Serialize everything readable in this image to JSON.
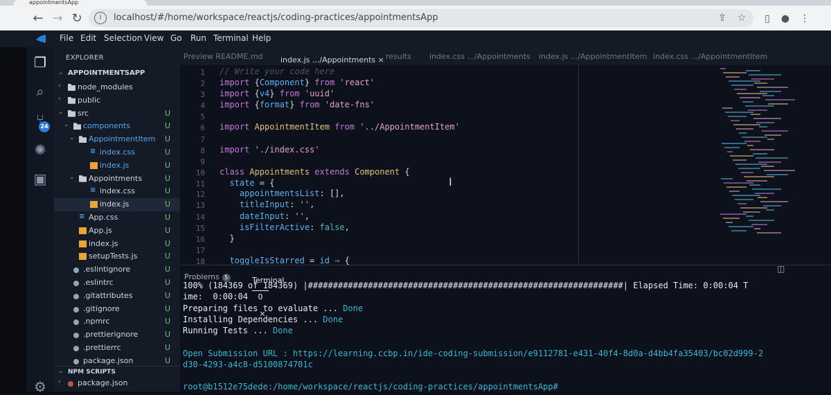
{
  "browser": {
    "tab_title": "appointmentsApp",
    "url": "localhost/#/home/workspace/reactjs/coding-practices/appointmentsApp"
  },
  "menu": [
    "File",
    "Edit",
    "Selection",
    "View",
    "Go",
    "Run",
    "Terminal",
    "Help"
  ],
  "activity_badge": "24",
  "explorer": {
    "header": "EXPLORER",
    "project": "APPOINTMENTSAPP",
    "rows": [
      {
        "label": "node_modules",
        "type": "folder",
        "chev": "›",
        "status": ""
      },
      {
        "label": "public",
        "type": "folder",
        "chev": "›",
        "status": ""
      },
      {
        "label": "src",
        "type": "folder",
        "chev": "⌄",
        "status": "U"
      },
      {
        "label": "components",
        "type": "folder",
        "chev": "⌄",
        "status": "U"
      },
      {
        "label": "AppointmentItem",
        "type": "folder",
        "chev": "⌄",
        "status": "U"
      },
      {
        "label": "index.css",
        "type": "css",
        "chev": "",
        "status": "U"
      },
      {
        "label": "index.js",
        "type": "js",
        "chev": "",
        "status": "U"
      },
      {
        "label": "Appointments",
        "type": "folder",
        "chev": "⌄",
        "status": "U"
      },
      {
        "label": "index.css",
        "type": "css",
        "chev": "",
        "status": "U"
      },
      {
        "label": "index.js",
        "type": "js",
        "chev": "",
        "status": "U"
      },
      {
        "label": "App.css",
        "type": "css",
        "chev": "",
        "status": "U"
      },
      {
        "label": "App.js",
        "type": "js",
        "chev": "",
        "status": "U"
      },
      {
        "label": "index.js",
        "type": "js",
        "chev": "",
        "status": "U"
      },
      {
        "label": "setupTests.js",
        "type": "js",
        "chev": "",
        "status": "U"
      },
      {
        "label": ".eslintignore",
        "type": "dot",
        "chev": "",
        "status": "U"
      },
      {
        "label": ".eslintrc",
        "type": "dot",
        "chev": "",
        "status": "U"
      },
      {
        "label": ".gitattributes",
        "type": "dot",
        "chev": "",
        "status": "U"
      },
      {
        "label": ".gitignore",
        "type": "dot",
        "chev": "",
        "status": "U"
      },
      {
        "label": ".npmrc",
        "type": "dot",
        "chev": "",
        "status": "U"
      },
      {
        "label": ".prettierignore",
        "type": "dot",
        "chev": "",
        "status": "U"
      },
      {
        "label": ".prettierrc",
        "type": "dot",
        "chev": "",
        "status": "U"
      },
      {
        "label": "package.json",
        "type": "dot",
        "chev": "",
        "status": "U"
      }
    ],
    "npm_header": "NPM SCRIPTS",
    "npm_item": "package.json"
  },
  "editor_tabs": [
    {
      "label": "Preview README.md",
      "active": false
    },
    {
      "label": "index.js .../Appointments",
      "active": true,
      "close": "×"
    },
    {
      "label": "results",
      "active": false
    },
    {
      "label": "index.css .../Appointments",
      "active": false
    },
    {
      "label": "index.js .../AppointmentItem",
      "active": false
    },
    {
      "label": "index.css .../AppointmentItem",
      "active": false
    }
  ],
  "code_lines": [
    {
      "n": "1",
      "html": "<span class='cm'>// Write your code here</span>"
    },
    {
      "n": "2",
      "html": "<span class='kw'>import</span> {<span class='pr'>Component</span>} <span class='kw'>from</span> <span class='st'>'react'</span>"
    },
    {
      "n": "3",
      "html": "<span class='kw'>import</span> {<span class='pr'>v4</span>} <span class='kw'>from</span> <span class='st'>'uuid'</span>"
    },
    {
      "n": "4",
      "html": "<span class='kw'>import</span> {<span class='pr'>format</span>} <span class='kw'>from</span> <span class='st'>'date-fns'</span>"
    },
    {
      "n": "5",
      "html": ""
    },
    {
      "n": "6",
      "html": "<span class='kw'>import</span> <span class='cl'>AppointmentItem</span> <span class='kw'>from</span> <span class='st'>'../AppointmentItem'</span>"
    },
    {
      "n": "7",
      "html": ""
    },
    {
      "n": "8",
      "html": "<span class='kw'>import</span> <span class='st'>'./index.css'</span>"
    },
    {
      "n": "9",
      "html": ""
    },
    {
      "n": "10",
      "html": "<span class='kw'>class</span> <span class='cl'>Appointments</span> <span class='kw'>extends</span> <span class='cl'>Component</span> {"
    },
    {
      "n": "11",
      "html": "  <span class='pr'>state</span> = {"
    },
    {
      "n": "12",
      "html": "    <span class='pr'>appointmentsList</span>: [],"
    },
    {
      "n": "13",
      "html": "    <span class='pr'>titleInput</span>: <span class='st'>''</span>,"
    },
    {
      "n": "14",
      "html": "    <span class='pr'>dateInput</span>: <span class='st'>''</span>,"
    },
    {
      "n": "15",
      "html": "    <span class='pr'>isFilterActive</span>: <span class='bo'>false</span>,"
    },
    {
      "n": "16",
      "html": "  }"
    },
    {
      "n": "17",
      "html": ""
    },
    {
      "n": "18",
      "html": "  <span class='pr'>toggleIsStarred</span> = <span class='pr'>id</span> <span class='kw'>⇒</span> {"
    }
  ],
  "panel": {
    "problems_label": "Problems",
    "problems_count": "5",
    "terminal_label": "Terminal 0",
    "terminal_close": "×",
    "lines": [
      {
        "html": "100% (184369 of 184369) |###############################################################| Elapsed Time: 0:00:04 T"
      },
      {
        "html": "ime:  0:00:04"
      },
      {
        "html": "Preparing files to evaluate ... <span class='done'>Done</span>"
      },
      {
        "html": "Installing Dependencies ... <span class='done'>Done</span>"
      },
      {
        "html": "Running Tests ... <span class='done'>Done</span>"
      },
      {
        "html": ""
      },
      {
        "html": "<span class='done'>Open Submission URL : https://learning.ccbp.in/ide-coding-submission/e9112781-e431-40f4-8d0a-d4bb4fa35403/bc02d999-2</span>"
      },
      {
        "html": "<span class='done'>d30-4293-a4c8-d5100874701c</span>"
      },
      {
        "html": ""
      },
      {
        "html": "<span class='done'>root@b1512e75dede:/home/workspace/reactjs/coding-practices/appointmentsApp#</span>"
      }
    ]
  }
}
